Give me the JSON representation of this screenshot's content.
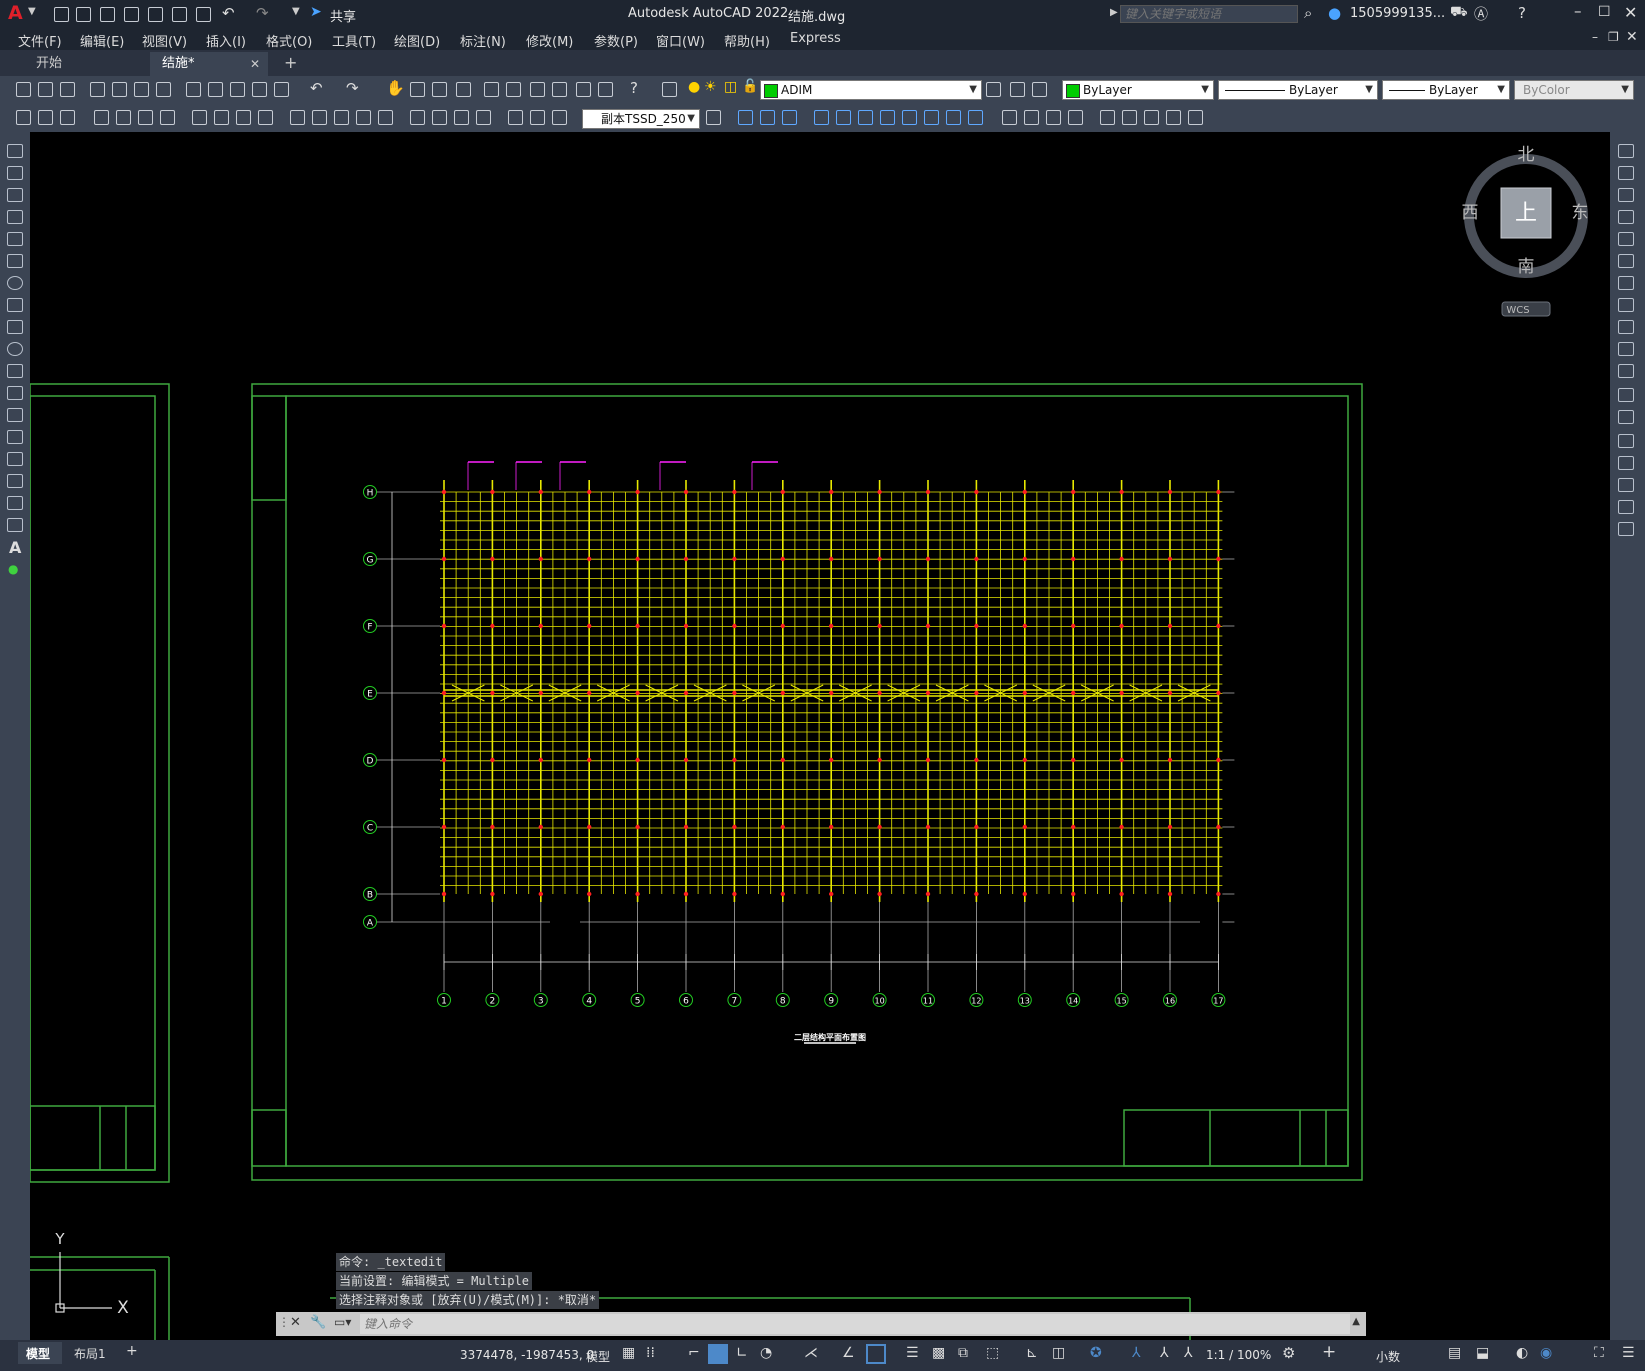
{
  "title_bar": {
    "app_title": "Autodesk AutoCAD 2022",
    "file_name": "结施.dwg",
    "share_label": "共享",
    "search_placeholder": "键入关键字或短语",
    "user": "1505999135...",
    "app_letter": "A"
  },
  "menu": {
    "items": [
      "文件(F)",
      "编辑(E)",
      "视图(V)",
      "插入(I)",
      "格式(O)",
      "工具(T)",
      "绘图(D)",
      "标注(N)",
      "修改(M)",
      "参数(P)",
      "窗口(W)",
      "帮助(H)",
      "Express"
    ]
  },
  "tabs": {
    "items": [
      "开始",
      "结施*"
    ],
    "active_index": 1,
    "add": "+"
  },
  "toolbar": {
    "layer_name": "ADIM",
    "layer_color": "#00cc00",
    "color_combo": "ByLayer",
    "linetype_combo": "ByLayer",
    "lineweight_combo": "ByLayer",
    "plotstyle_combo": "ByColor",
    "textstyle_combo": "副本TSSD_250"
  },
  "viewcube": {
    "north": "北",
    "south": "南",
    "east": "东",
    "west": "西",
    "face": "上",
    "wcs": "WCS"
  },
  "drawing": {
    "row_labels": [
      "H",
      "G",
      "F",
      "E",
      "D",
      "C",
      "B",
      "A"
    ],
    "column_labels": [
      "1",
      "2",
      "3",
      "4",
      "5",
      "6",
      "7",
      "8",
      "9",
      "10",
      "11",
      "12",
      "13",
      "14",
      "15",
      "16",
      "17"
    ],
    "plan_title": "二层结构平面布置图"
  },
  "ucs": {
    "y": "Y",
    "x": "X"
  },
  "command": {
    "history": [
      "命令: _textedit",
      "当前设置: 编辑模式 = Multiple",
      "选择注释对象或 [放弃(U)/模式(M)]: *取消*"
    ],
    "placeholder": "键入命令"
  },
  "layout_tabs": [
    "模型",
    "布局1",
    "+"
  ],
  "status": {
    "coords": "3374478, -1987453, 0",
    "model": "模型",
    "scale": "1:1 / 100%",
    "units": "小数"
  },
  "colors": {
    "frame_green": "#3fa83f",
    "grid_yellow": "#e8e800",
    "axis_green": "#22cc22",
    "marker_red": "#ff2020",
    "tag_magenta": "#ff22ff"
  }
}
